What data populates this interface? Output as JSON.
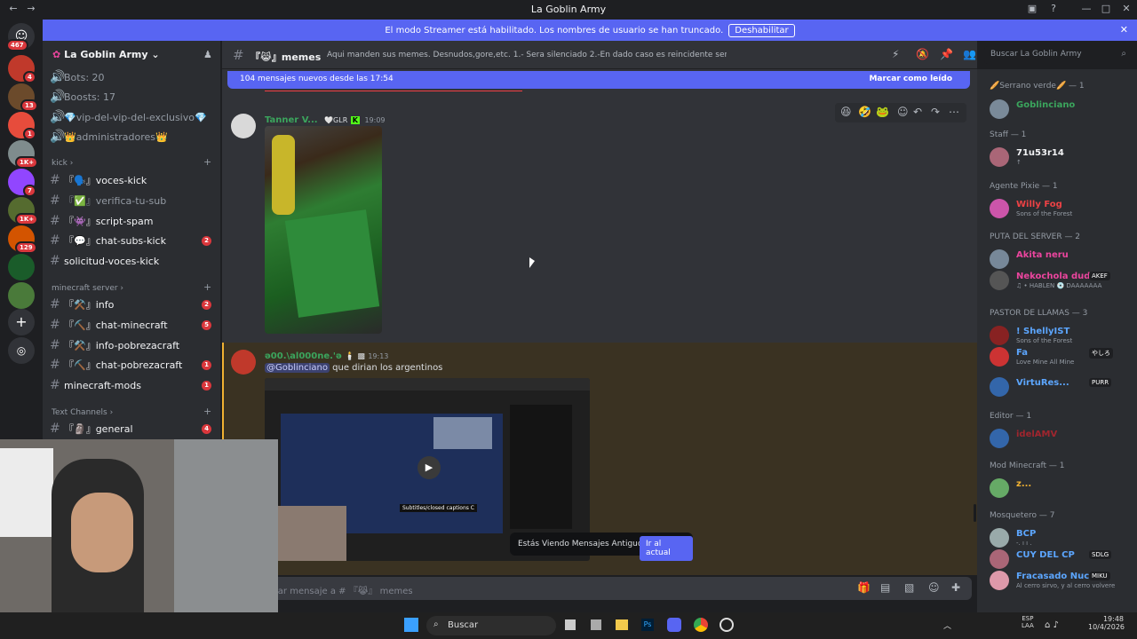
{
  "window": {
    "title": "La Goblin Army"
  },
  "banner": {
    "message": "El modo Streamer está habilitado. Los nombres de usuario se han truncado.",
    "button": "Deshabilitar"
  },
  "server_badges": [
    "467",
    "4",
    "13",
    "1",
    "1K+",
    "7",
    "1K+",
    "129"
  ],
  "sidebar": {
    "server_name": "La Goblin Army",
    "stats": [
      "Bots: 20",
      "Boosts: 17"
    ],
    "top_channels": [
      "💎vip-del-vip-del-exclusivo💎",
      "👑administradores👑"
    ],
    "categories": [
      "kick",
      "minecraft server",
      "Text Channels"
    ],
    "kick_channels": [
      {
        "name": "『🗣️』voces-kick",
        "count": ""
      },
      {
        "name": "『✅』verifica-tu-sub",
        "count": ""
      },
      {
        "name": "『👾』script-spam",
        "count": ""
      },
      {
        "name": "『💬』chat-subs-kick",
        "count": "2"
      },
      {
        "name": "solicitud-voces-kick",
        "count": ""
      }
    ],
    "mc_channels": [
      {
        "name": "『⚒️』info",
        "count": "2"
      },
      {
        "name": "『⛏️』chat-minecraft",
        "count": "5"
      },
      {
        "name": "『⚒️』info-pobrezacraft",
        "count": ""
      },
      {
        "name": "『⛏️』chat-pobrezacraft",
        "count": "1"
      },
      {
        "name": "minecraft-mods",
        "count": "1"
      }
    ],
    "text_channels": [
      {
        "name": "『🗿』general",
        "count": "4"
      }
    ]
  },
  "channel": {
    "name": "『😹』memes",
    "topic": "Aqui manden sus memes. Desnudos,gore,etc. 1.- Sera silenciado 2.-En dado caso es reincidente sera baneado"
  },
  "search": {
    "placeholder": "Buscar La Goblin Army"
  },
  "new_messages": {
    "text": "104 mensajes nuevos desde las 17:54",
    "action": "Marcar como leído"
  },
  "messages": [
    {
      "author": "Tanner V...",
      "tag": "GLR",
      "time": "19:09"
    },
    {
      "author": "ə00.\\al000ne.'ə",
      "time": "19:13",
      "mention": "@Goblinciano",
      "text": " que dirian los argentinos"
    }
  ],
  "video": {
    "caption": "Subtitles/closed captions",
    "cc": "C"
  },
  "jump": {
    "text": "Estás Viendo Mensajes Antiguos",
    "button": "Ir al actual"
  },
  "composer": {
    "placeholder": "iar mensaje a # 『😹』 memes"
  },
  "members": {
    "groups": [
      {
        "label": "🥖Serrano verde🥖 — 1",
        "members": [
          {
            "name": "Goblinciano",
            "color": "#3ba55d",
            "sub": ""
          }
        ]
      },
      {
        "label": "Staff — 1",
        "members": [
          {
            "name": "71u53r14",
            "color": "#f2f3f5",
            "sub": "↑"
          }
        ]
      },
      {
        "label": "Agente Pixie — 1",
        "members": [
          {
            "name": "Willy Fog",
            "color": "#ed4245",
            "sub": "Sons of the Forest"
          }
        ]
      },
      {
        "label": "PUTA DEL SERVER — 2",
        "members": [
          {
            "name": "Akita neru",
            "color": "#eb459e",
            "sub": ""
          },
          {
            "name": "Nekochola dudu :3",
            "color": "#eb459e",
            "sub": "♫ • HABLEN 💿 DAAAAAAA",
            "tag": "AKEF"
          }
        ]
      },
      {
        "label": "PASTOR DE LLAMAS — 3",
        "members": [
          {
            "name": "! ShellyIST",
            "color": "#5ca6ff",
            "sub": "Sons of the Forest"
          },
          {
            "name": "Fa",
            "color": "#5ca6ff",
            "sub": "Love Mine All Mine",
            "tag": "やしろ"
          },
          {
            "name": "VirtuRes...",
            "color": "#5ca6ff",
            "sub": "",
            "tag": "PURR"
          }
        ]
      },
      {
        "label": "Editor — 1",
        "members": [
          {
            "name": "idelAMV",
            "color": "#a0252e",
            "sub": ""
          }
        ]
      },
      {
        "label": "Mod Minecraft — 1",
        "members": [
          {
            "name": "z...",
            "color": "#f0b132",
            "sub": ""
          }
        ]
      },
      {
        "label": "Mosquetero — 7",
        "members": [
          {
            "name": "BCP",
            "color": "#5ca6ff",
            "sub": "-. ı ı ."
          },
          {
            "name": "CUY DEL CP",
            "color": "#5ca6ff",
            "sub": "",
            "tag": "SDLG"
          },
          {
            "name": "Fracasado Nuclear",
            "color": "#5ca6ff",
            "sub": "Al cerro sirvo, y al cerro volvere",
            "tag": "MIKU"
          }
        ]
      }
    ]
  },
  "taskbar": {
    "search": "Buscar",
    "lang1": "ESP",
    "lang2": "LAA",
    "time": "19:48",
    "date": "10/4/2026"
  }
}
